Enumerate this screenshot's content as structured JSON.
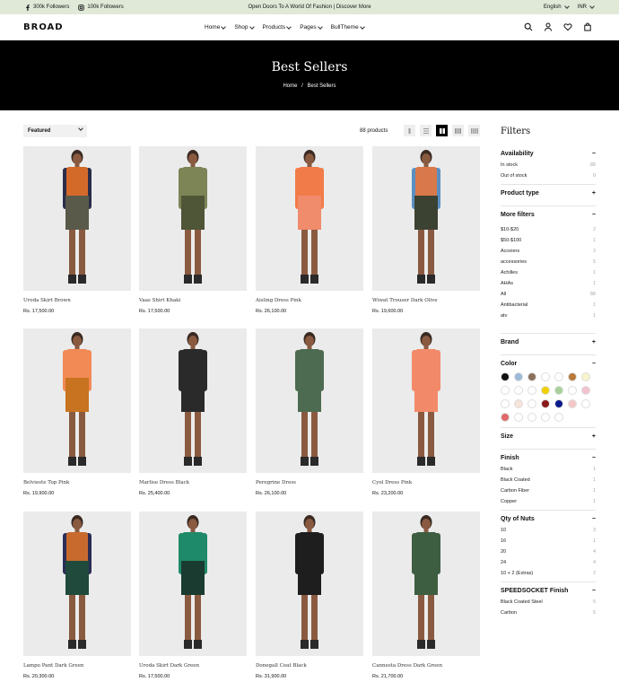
{
  "topbar": {
    "facebook": "300k Followers",
    "instagram": "100k Followers",
    "announcement": "Open Doors To A World Of Fashion | Discover More",
    "language": "English",
    "currency": "INR"
  },
  "header": {
    "logo": "BROAD",
    "nav": [
      "Home",
      "Shop",
      "Products",
      "Pages",
      "BullTheme"
    ]
  },
  "hero": {
    "title": "Best Sellers",
    "breadcrumb_home": "Home",
    "breadcrumb_sep": "/",
    "breadcrumb_current": "Best Sellers"
  },
  "toolbar": {
    "sort": "Featured",
    "count": "88 products"
  },
  "products": [
    {
      "name": "Uroda Skirt Brown",
      "price": "Rs. 17,500.00",
      "top": "#d46a2a",
      "bottom": "#5a5a4a",
      "arms": "#2a2d4a",
      "bg": "#ebebeb"
    },
    {
      "name": "Vaas Shirt Khaki",
      "price": "Rs. 17,500.00",
      "top": "#7d8456",
      "bottom": "#4f5537",
      "arms": "#7d8456",
      "bg": "#ebebeb"
    },
    {
      "name": "Aisling Dress Pink",
      "price": "Rs. 26,100.00",
      "top": "#f27b4a",
      "bottom": "#f08b6b",
      "arms": "#f27b4a",
      "bg": "#ebebeb"
    },
    {
      "name": "Wiwat Trouser Dark Olive",
      "price": "Rs. 19,600.00",
      "top": "#d9784a",
      "bottom": "#3b4232",
      "arms": "#5a8fc2",
      "bg": "#ebebeb"
    },
    {
      "name": "Belvieste Top Pink",
      "price": "Rs. 19,900.00",
      "top": "#f28a55",
      "bottom": "#c8731f",
      "arms": "#f28a55",
      "bg": "#ebebeb"
    },
    {
      "name": "Marlise Dress Black",
      "price": "Rs. 25,400.00",
      "top": "#2a2a2a",
      "bottom": "#2a2a2a",
      "arms": "#2a2a2a",
      "bg": "#ebebeb"
    },
    {
      "name": "Peregrine Dress",
      "price": "Rs. 26,100.00",
      "top": "#4d6b50",
      "bottom": "#4d6b50",
      "arms": "#4d6b50",
      "bg": "#ebebeb"
    },
    {
      "name": "Cyol Dress Pink",
      "price": "Rs. 23,200.00",
      "top": "#f28a6a",
      "bottom": "#f28a6a",
      "arms": "#f28a6a",
      "bg": "#ebebeb"
    },
    {
      "name": "Lampo Pant Dark Green",
      "price": "Rs. 20,300.00",
      "top": "#c86a2e",
      "bottom": "#1f4a3c",
      "arms": "#2a2d55",
      "bg": "#ebebeb"
    },
    {
      "name": "Uroda Skirt Dark Green",
      "price": "Rs. 17,500.00",
      "top": "#1f8a6a",
      "bottom": "#1a3b30",
      "arms": "#1f8a6a",
      "bg": "#ebebeb"
    },
    {
      "name": "Donegall Coat Black",
      "price": "Rs. 31,900.00",
      "top": "#1e1e1e",
      "bottom": "#1e1e1e",
      "arms": "#1e1e1e",
      "bg": "#ebebeb"
    },
    {
      "name": "Cannesta Dress Dark Green",
      "price": "Rs. 21,700.00",
      "top": "#3d5e40",
      "bottom": "#3d5e40",
      "arms": "#3d5e40",
      "bg": "#ebebeb"
    }
  ],
  "filters": {
    "title": "Filters",
    "availability": {
      "label": "Availability",
      "items": [
        {
          "name": "In stock",
          "count": "88"
        },
        {
          "name": "Out of stock",
          "count": "0"
        }
      ]
    },
    "product_type": {
      "label": "Product type"
    },
    "more_filters": {
      "label": "More filters",
      "items": [
        {
          "name": "$10-$20",
          "count": "2"
        },
        {
          "name": "$50-$100",
          "count": "1"
        },
        {
          "name": "Acceiers",
          "count": "2"
        },
        {
          "name": "accessories",
          "count": "5"
        },
        {
          "name": "Achilles",
          "count": "1"
        },
        {
          "name": "AHAs",
          "count": "1"
        },
        {
          "name": "All",
          "count": "88"
        },
        {
          "name": "Antibacterial",
          "count": "1"
        },
        {
          "name": "atv",
          "count": "1"
        }
      ]
    },
    "brand": {
      "label": "Brand"
    },
    "color": {
      "label": "Color",
      "swatches": [
        "#111111",
        "#9bbad8",
        "#8b6f5a",
        "#ffffff",
        "#ffffff",
        "#b8783a",
        "#f8f4cc",
        "#ffffff",
        "#ffffff",
        "#ffffff",
        "#f0d000",
        "#a8d29a",
        "#ffffff",
        "#f2c3cf",
        "#ffffff",
        "#f6e3da",
        "#ffffff",
        "#8a1a1a",
        "#0a1a8a",
        "#f3c7c7",
        "#ffffff",
        "#e06a6a",
        "#ffffff",
        "#ffffff",
        "#ffffff",
        "#ffffff"
      ]
    },
    "size": {
      "label": "Size"
    },
    "finish": {
      "label": "Finish",
      "items": [
        {
          "name": "Black",
          "count": "1"
        },
        {
          "name": "Black Coated",
          "count": "1"
        },
        {
          "name": "Carbon Fiber",
          "count": "1"
        },
        {
          "name": "Copper",
          "count": "1"
        }
      ]
    },
    "qty": {
      "label": "Qty of Nuts",
      "items": [
        {
          "name": "10",
          "count": "3"
        },
        {
          "name": "16",
          "count": "1"
        },
        {
          "name": "20",
          "count": "4"
        },
        {
          "name": "24",
          "count": "4"
        },
        {
          "name": "10 + 2 (Extras)",
          "count": "2"
        }
      ]
    },
    "speedsocket": {
      "label": "SPEEDSOCKET Finish",
      "items": [
        {
          "name": "Black Coated Steel",
          "count": "5"
        },
        {
          "name": "Carbon",
          "count": "5"
        }
      ]
    }
  }
}
